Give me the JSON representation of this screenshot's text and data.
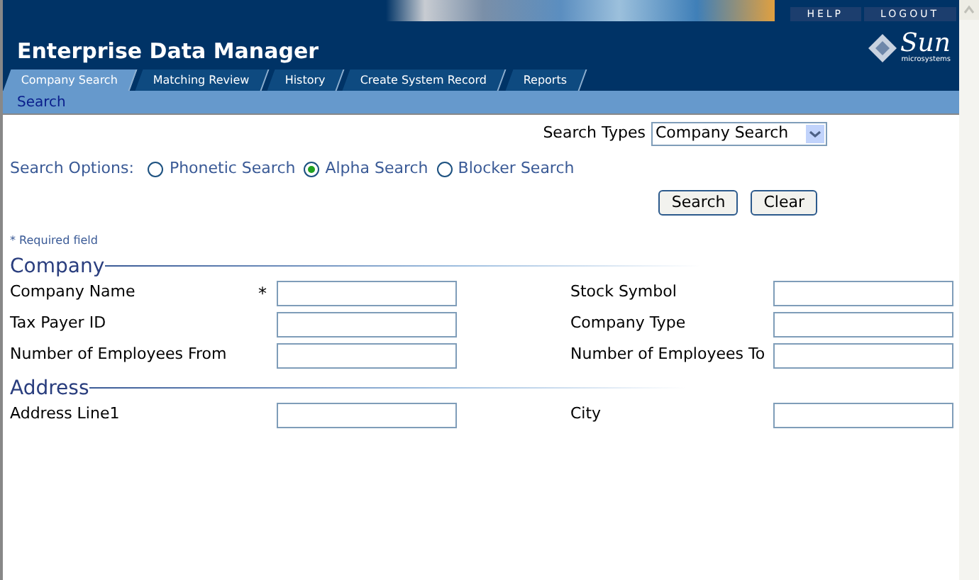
{
  "header": {
    "title": "Enterprise Data Manager",
    "links": [
      "HELP",
      "LOGOUT"
    ],
    "logo": "Sun",
    "logo_sub": "microsystems"
  },
  "tabs": [
    {
      "label": "Company Search",
      "selected": true
    },
    {
      "label": "Matching Review",
      "selected": false
    },
    {
      "label": "History",
      "selected": false
    },
    {
      "label": "Create System Record",
      "selected": false
    },
    {
      "label": "Reports",
      "selected": false
    }
  ],
  "subnav": "Search",
  "search_types": {
    "label": "Search Types",
    "value": "Company Search"
  },
  "search_options": {
    "label": "Search Options:",
    "options": [
      {
        "label": "Phonetic Search",
        "selected": false
      },
      {
        "label": "Alpha Search",
        "selected": true
      },
      {
        "label": "Blocker Search",
        "selected": false
      }
    ]
  },
  "buttons": [
    "Search",
    "Clear"
  ],
  "required_note": "* Required field",
  "sections": [
    {
      "title": "Company",
      "rows": [
        [
          {
            "label": "Company Name",
            "required_mark": "*"
          },
          {
            "label": "Stock Symbol"
          }
        ],
        [
          {
            "label": "Tax Payer ID"
          },
          {
            "label": "Company Type"
          }
        ],
        [
          {
            "label": "Number of Employees From"
          },
          {
            "label": "Number of Employees To"
          }
        ]
      ]
    },
    {
      "title": "Address",
      "rows": [
        [
          {
            "label": "Address Line1"
          },
          {
            "label": "City"
          }
        ]
      ]
    }
  ]
}
